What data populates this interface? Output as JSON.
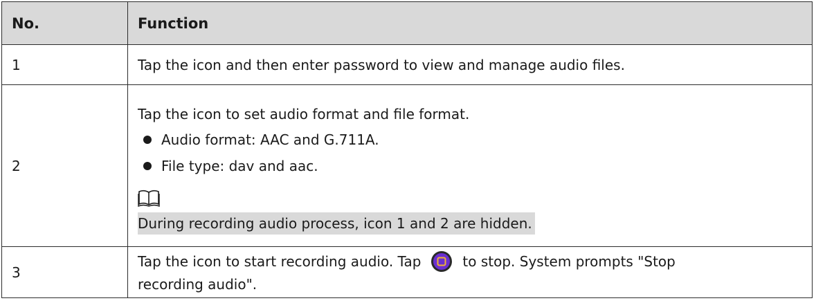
{
  "table": {
    "headers": {
      "no": "No.",
      "function": "Function"
    },
    "rows": [
      {
        "no": "1",
        "text": "Tap the icon and then enter password to view and manage audio files."
      },
      {
        "no": "2",
        "intro": "Tap the icon to set audio format and file format.",
        "bullets": [
          "Audio format: AAC and G.711A.",
          "File type: dav and aac."
        ],
        "note_icon": "book-note-icon",
        "note": "During recording audio process, icon 1 and 2 are hidden."
      },
      {
        "no": "3",
        "text_before_icon": "Tap the icon to start recording audio. Tap",
        "icon": "stop-record-icon",
        "text_after_icon": "to stop. System prompts \"Stop",
        "text_line2": "recording audio\"."
      }
    ]
  },
  "colors": {
    "header_bg": "#d9d9d9",
    "note_highlight": "#d9d9d9",
    "border": "#2b2b2b",
    "stop_icon_ring": "#f2b234",
    "stop_icon_fill": "#6a2fd0"
  }
}
